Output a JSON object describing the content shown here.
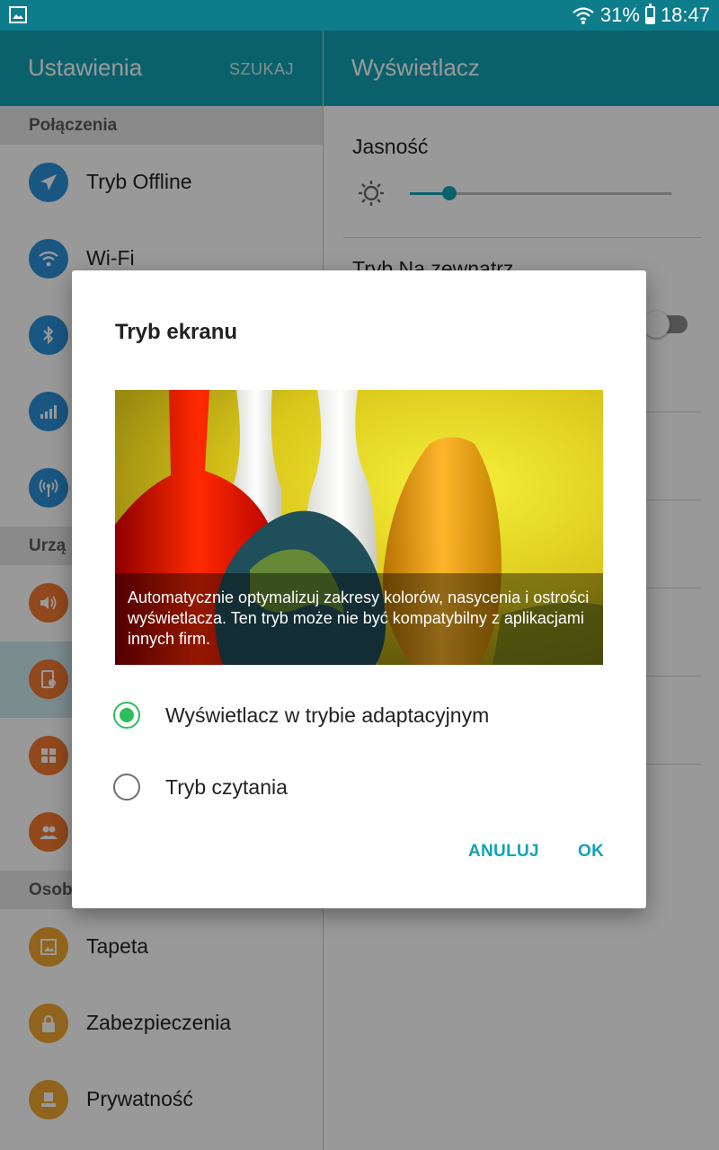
{
  "status_bar": {
    "battery": "31%",
    "time": "18:47",
    "icons": [
      "gallery-icon",
      "wifi-icon",
      "battery-icon"
    ]
  },
  "left_header": {
    "title": "Ustawienia",
    "search_label": "SZUKAJ"
  },
  "right_header": {
    "title": "Wyświetlacz"
  },
  "sections": {
    "connections": "Połączenia",
    "device": "Urzą",
    "personal": "Osob"
  },
  "items": {
    "offline": "Tryb Offline",
    "wifi": "Wi-Fi",
    "wallpaper": "Tapeta",
    "security": "Zabezpieczenia",
    "privacy": "Prywatność"
  },
  "display": {
    "brightness_label": "Jasność",
    "brightness_level": 0.15,
    "outdoor_label": "Tryb Na zewnątrz",
    "outdoor_enabled": false
  },
  "dialog": {
    "title": "Tryb ekranu",
    "caption": "Automatycznie optymalizuj zakresy kolorów, nasycenia i ostrości wyświetlacza. Ten tryb może nie być kompatybilny z aplikacjami innych firm.",
    "options": [
      {
        "label": "Wyświetlacz w trybie adaptacyjnym",
        "selected": true
      },
      {
        "label": "Tryb czytania",
        "selected": false
      }
    ],
    "cancel": "ANULUJ",
    "ok": "OK"
  },
  "colors": {
    "status_bar": "#0e7d8b",
    "app_bar": "#13a2b3",
    "accent": "#13a2b3",
    "radio_selected": "#2ebd5b",
    "icon_blue": "#2a8fd8",
    "icon_orange": "#f2782f",
    "icon_yellow": "#f0a72f"
  }
}
